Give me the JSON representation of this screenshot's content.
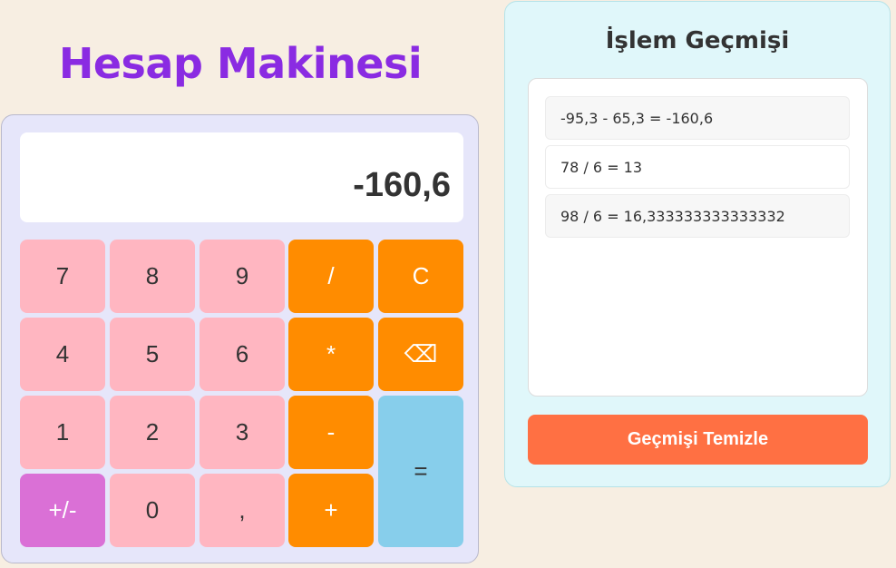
{
  "app_title": "Hesap Makinesi",
  "display": {
    "value": "-160,6"
  },
  "keys": {
    "k7": "7",
    "k8": "8",
    "k9": "9",
    "div": "/",
    "clear": "C",
    "k4": "4",
    "k5": "5",
    "k6": "6",
    "mul": "*",
    "backspace": "⌫",
    "k1": "1",
    "k2": "2",
    "k3": "3",
    "sub": "-",
    "equals": "=",
    "negate": "+/-",
    "k0": "0",
    "comma": ",",
    "add": "+"
  },
  "history": {
    "title": "İşlem Geçmişi",
    "items": [
      "-95,3 - 65,3 = -160,6",
      "78 / 6 = 13",
      "98 / 6 = 16,333333333333332"
    ],
    "clear_label": "Geçmişi Temizle"
  },
  "colors": {
    "title": "#8a2be2",
    "number_key": "#ffb6c1",
    "operator_key": "#ff8c00",
    "negate_key": "#da70d6",
    "equals_key": "#87ceeb",
    "clear_history_button": "#ff7043"
  }
}
